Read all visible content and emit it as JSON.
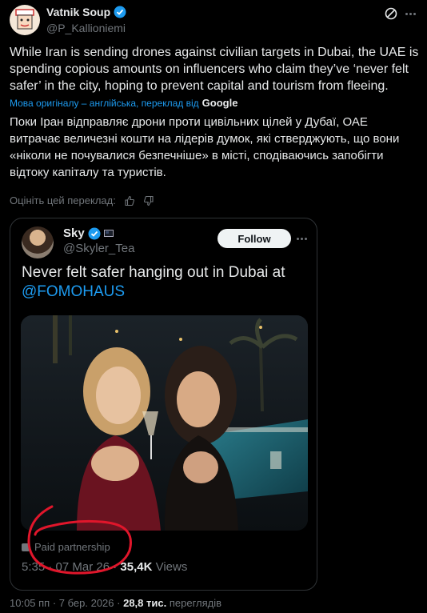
{
  "author": {
    "name": "Vatnik Soup",
    "handle": "@P_Kallioniemi",
    "avatar_icon": "soup-character-avatar"
  },
  "tweet": {
    "text": "While Iran is sending drones against civilian targets in Dubai, the UAE is spending copious amounts on influencers who claim they’ve ‘never felt safer’ in the city, hoping to prevent capital and tourism from fleeing.",
    "translation_note": "Мова оригіналу – англійська, переклад від",
    "translation_provider": "Google",
    "translated_text": "Поки Іран відправляє дрони проти цивільних цілей у Дубаї, ОАЕ витрачає величезні кошти на лідерів думок, які стверджують, що вони «ніколи не почувалися безпечніше» в місті, сподіваючись запобігти відтоку капіталу та туристів.",
    "rate_label": "Оцініть цей переклад:",
    "timestamp": "10:05 пп · 7 бер. 2026 ·",
    "views_count": "28,8 тис.",
    "views_label": "переглядів"
  },
  "quoted": {
    "name": "Sky",
    "handle": "@Skyler_Tea",
    "follow_label": "Follow",
    "text": "Never felt safer hanging out in Dubai at",
    "mention": "@FOMOHAUS",
    "paid_label": "Paid partnership",
    "timestamp": "5:35 · 07 Mar 26 ·",
    "views_count": "35,4K",
    "views_label": "Views"
  },
  "colors": {
    "accent": "#1d9bf0",
    "annotation": "#e0162b"
  }
}
